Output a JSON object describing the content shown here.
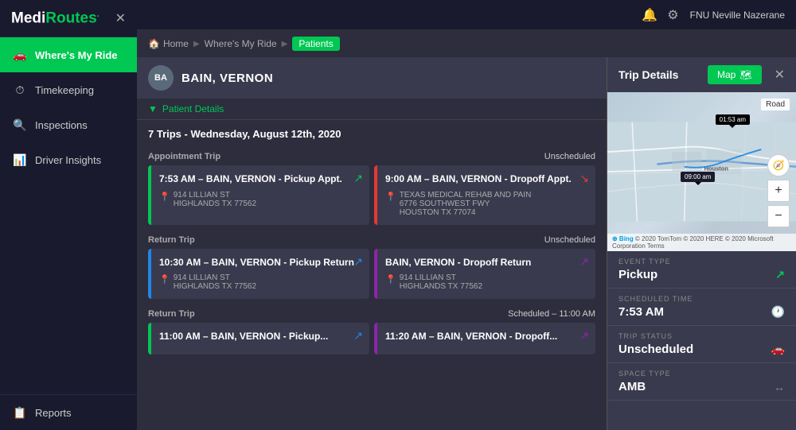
{
  "app": {
    "name": "MediRoutes",
    "name_part1": "Medi",
    "name_part2": "Routes"
  },
  "topbar": {
    "user": "FNU Neville Nazerane",
    "bell_icon": "🔔",
    "gear_icon": "⚙"
  },
  "sidebar": {
    "nav_items": [
      {
        "id": "wheres-my-ride",
        "label": "Where's My Ride",
        "icon": "🚗",
        "active": true
      },
      {
        "id": "timekeeping",
        "label": "Timekeeping",
        "icon": "⏱",
        "active": false
      },
      {
        "id": "inspections",
        "label": "Inspections",
        "icon": "🔍",
        "active": false
      },
      {
        "id": "driver-insights",
        "label": "Driver Insights",
        "icon": "📊",
        "active": false
      },
      {
        "id": "reports",
        "label": "Reports",
        "icon": "📋",
        "active": false
      }
    ]
  },
  "breadcrumb": {
    "home": "Home",
    "wheres_my_ride": "Where's My Ride",
    "patients": "Patients"
  },
  "patient": {
    "avatar_initials": "BA",
    "name": "BAIN, VERNON",
    "details_toggle": "Patient Details"
  },
  "trips": {
    "header": "7 Trips - Wednesday, August 12th, 2020",
    "groups": [
      {
        "label": "Appointment Trip",
        "status": "Unscheduled",
        "cards": [
          {
            "type": "pickup",
            "time": "7:53 AM – BAIN, VERNON - Pickup Appt.",
            "address_line1": "914 LILLIAN ST",
            "address_line2": "HIGHLANDS TX 77562",
            "arrow_class": "arrow-green"
          },
          {
            "type": "dropoff",
            "time": "9:00 AM – BAIN, VERNON - Dropoff Appt.",
            "address_line1": "TEXAS MEDICAL REHAB AND PAIN",
            "address_line2": "6776 SOUTHWEST FWY",
            "address_line3": "HOUSTON TX 77074",
            "arrow_class": "arrow-red"
          }
        ]
      },
      {
        "label": "Return Trip",
        "status": "Unscheduled",
        "cards": [
          {
            "type": "pickup-return",
            "time": "10:30 AM – BAIN, VERNON - Pickup Return",
            "address_line1": "914 LILLIAN ST",
            "address_line2": "HIGHLANDS TX 77562",
            "arrow_class": "arrow-blue"
          },
          {
            "type": "dropoff-return",
            "time": "BAIN, VERNON - Dropoff Return",
            "address_line1": "914 LILLIAN ST",
            "address_line2": "HIGHLANDS TX 77562",
            "arrow_class": "arrow-purple"
          }
        ]
      },
      {
        "label": "Return Trip",
        "status": "Scheduled – 11:00 AM",
        "cards": [
          {
            "type": "pickup-sched",
            "time": "11:00 AM – BAIN, VERNON - Pickup...",
            "address_line1": "",
            "address_line2": "",
            "arrow_class": "arrow-blue"
          },
          {
            "type": "dropoff-sched",
            "time": "11:20 AM – BAIN, VERNON - Dropoff...",
            "address_line1": "",
            "address_line2": "",
            "arrow_class": "arrow-purple"
          }
        ]
      }
    ]
  },
  "trip_details": {
    "title": "Trip Details",
    "map_button": "Map",
    "road_label": "Road",
    "map_pin1": "01:53 am",
    "map_pin2": "09:00 am",
    "fields": [
      {
        "label": "EVENT TYPE",
        "value": "Pickup",
        "icon_type": "arrow-green"
      },
      {
        "label": "SCHEDULED TIME",
        "value": "7:53 AM",
        "icon_type": "clock"
      },
      {
        "label": "TRIP STATUS",
        "value": "Unscheduled",
        "icon_type": "car"
      },
      {
        "label": "SPACE TYPE",
        "value": "AMB",
        "icon_type": "arrows"
      }
    ]
  }
}
